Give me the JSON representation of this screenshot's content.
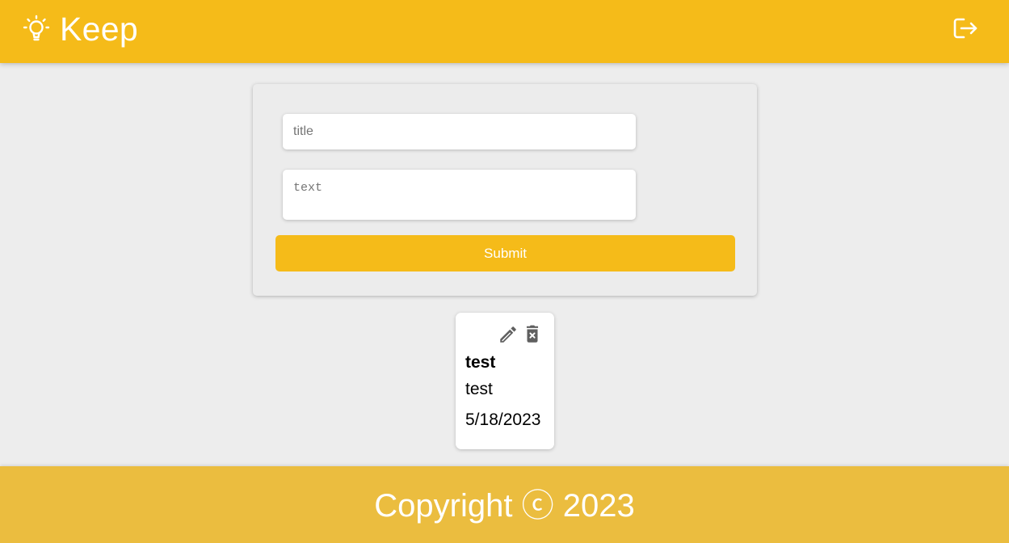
{
  "header": {
    "app_title": "Keep",
    "brand_icon": "lightbulb-icon",
    "logout_icon": "logout-icon"
  },
  "form": {
    "title_placeholder": "title",
    "text_placeholder": "text",
    "submit_label": "Submit"
  },
  "notes": [
    {
      "title": "test",
      "body": "test",
      "date": "5/18/2023",
      "actions": [
        "edit-icon",
        "delete-icon"
      ]
    }
  ],
  "footer": {
    "copyright": "Copyright ⓒ 2023"
  },
  "colors": {
    "brand": "#f5bb19",
    "footer": "#ebbd3f",
    "background": "#ededed",
    "icon": "#5f5f5f"
  }
}
